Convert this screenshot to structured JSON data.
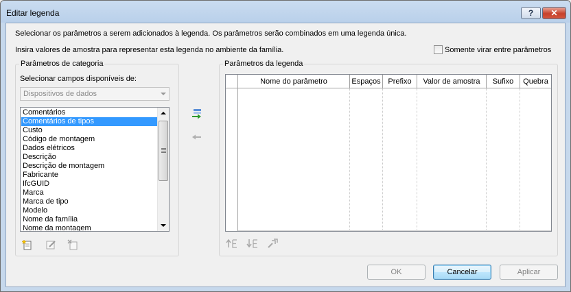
{
  "window": {
    "title": "Editar legenda",
    "help_label": "?",
    "close_label": "✕"
  },
  "intro": {
    "line1": "Selecionar os parâmetros a serem adicionados à legenda. Os parâmetros serão combinados em uma legenda única.",
    "line2": "Insira valores de amostra para representar esta legenda no ambiente da família."
  },
  "wrap_option": {
    "label": "Somente virar entre parâmetros",
    "checked": false
  },
  "category": {
    "group_title": "Parâmetros de categoria",
    "select_label": "Selecionar campos disponíveis de:",
    "combo_value": "Dispositivos de dados",
    "items": [
      "Comentários",
      "Comentários de tipos",
      "Custo",
      "Código de montagem",
      "Dados elétricos",
      "Descrição",
      "Descrição de montagem",
      "Fabricante",
      "IfcGUID",
      "Marca",
      "Marca de tipo",
      "Modelo",
      "Nome da família",
      "Nome da montagem"
    ],
    "selected_index": 1,
    "tool_icons": [
      "new-parameter-icon",
      "edit-parameter-icon",
      "delete-parameter-icon"
    ]
  },
  "transfer": {
    "add_icon": "add-to-label-icon",
    "remove_icon": "remove-from-label-icon"
  },
  "label_params": {
    "group_title": "Parâmetros da legenda",
    "columns": [
      "Nome do parâmetro",
      "Espaços",
      "Prefixo",
      "Valor de amostra",
      "Sufixo",
      "Quebra"
    ],
    "rows": [],
    "tool_icons": [
      "move-up-icon",
      "move-down-icon",
      "sort-icon"
    ]
  },
  "buttons": {
    "ok": "OK",
    "cancel": "Cancelar",
    "apply": "Aplicar"
  },
  "colors": {
    "selection": "#3399ff",
    "titlebar": "#c6d8ec",
    "close": "#c6402c"
  }
}
